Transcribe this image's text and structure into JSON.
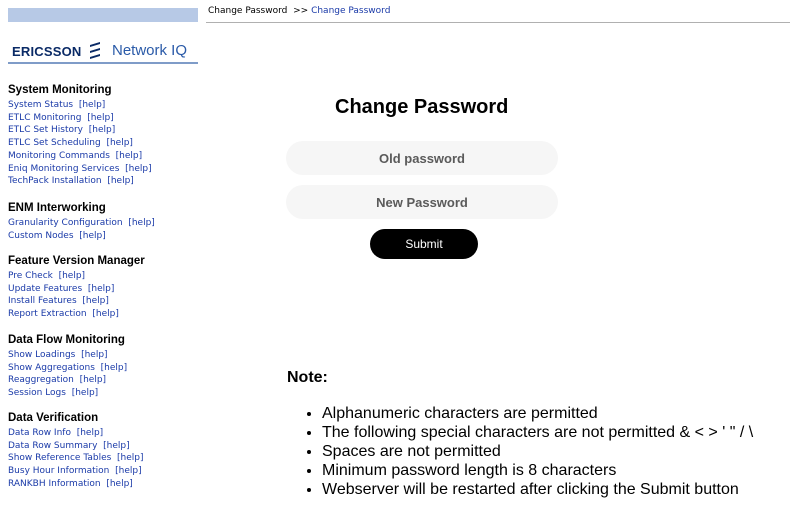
{
  "logo": {
    "company": "ERICSSON",
    "product": "Network IQ"
  },
  "breadcrumb": {
    "root": "Change Password",
    "separator": ">>",
    "current": "Change Password"
  },
  "sidebar": {
    "sections": [
      {
        "heading": "System Monitoring",
        "items": [
          {
            "label": "System Status",
            "help": "[help]"
          },
          {
            "label": "ETLC Monitoring",
            "help": "[help]"
          },
          {
            "label": "ETLC Set History",
            "help": "[help]"
          },
          {
            "label": "ETLC Set Scheduling",
            "help": "[help]"
          },
          {
            "label": "Monitoring Commands",
            "help": "[help]"
          },
          {
            "label": "Eniq Monitoring Services",
            "help": "[help]"
          },
          {
            "label": "TechPack Installation",
            "help": "[help]"
          }
        ]
      },
      {
        "heading": "ENM Interworking",
        "items": [
          {
            "label": "Granularity Configuration",
            "help": "[help]"
          },
          {
            "label": "Custom Nodes",
            "help": "[help]"
          }
        ]
      },
      {
        "heading": "Feature Version Manager",
        "items": [
          {
            "label": "Pre Check",
            "help": "[help]"
          },
          {
            "label": "Update Features",
            "help": "[help]"
          },
          {
            "label": "Install Features",
            "help": "[help]"
          },
          {
            "label": "Report Extraction",
            "help": "[help]"
          }
        ]
      },
      {
        "heading": "Data Flow Monitoring",
        "items": [
          {
            "label": "Show Loadings",
            "help": "[help]"
          },
          {
            "label": "Show Aggregations",
            "help": "[help]"
          },
          {
            "label": "Reaggregation",
            "help": "[help]"
          },
          {
            "label": "Session Logs",
            "help": "[help]"
          }
        ]
      },
      {
        "heading": "Data Verification",
        "items": [
          {
            "label": "Data Row Info",
            "help": "[help]"
          },
          {
            "label": "Data Row Summary",
            "help": "[help]"
          },
          {
            "label": "Show Reference Tables",
            "help": "[help]"
          },
          {
            "label": "Busy Hour Information",
            "help": "[help]"
          },
          {
            "label": "RANKBH Information",
            "help": "[help]"
          }
        ]
      }
    ]
  },
  "form": {
    "title": "Change Password",
    "old_placeholder": "Old password",
    "new_placeholder": "New Password",
    "submit_label": "Submit"
  },
  "notes": {
    "title": "Note:",
    "items": [
      "Alphanumeric characters are permitted",
      "The following special characters are not permitted & < > ' \" / \\",
      "Spaces are not permitted",
      "Minimum password length is 8 characters",
      "Webserver will be restarted after clicking the Submit button"
    ]
  },
  "colors": {
    "link": "#1a3aa8",
    "logo_bar": "#b7c9e6",
    "button": "#000000"
  }
}
